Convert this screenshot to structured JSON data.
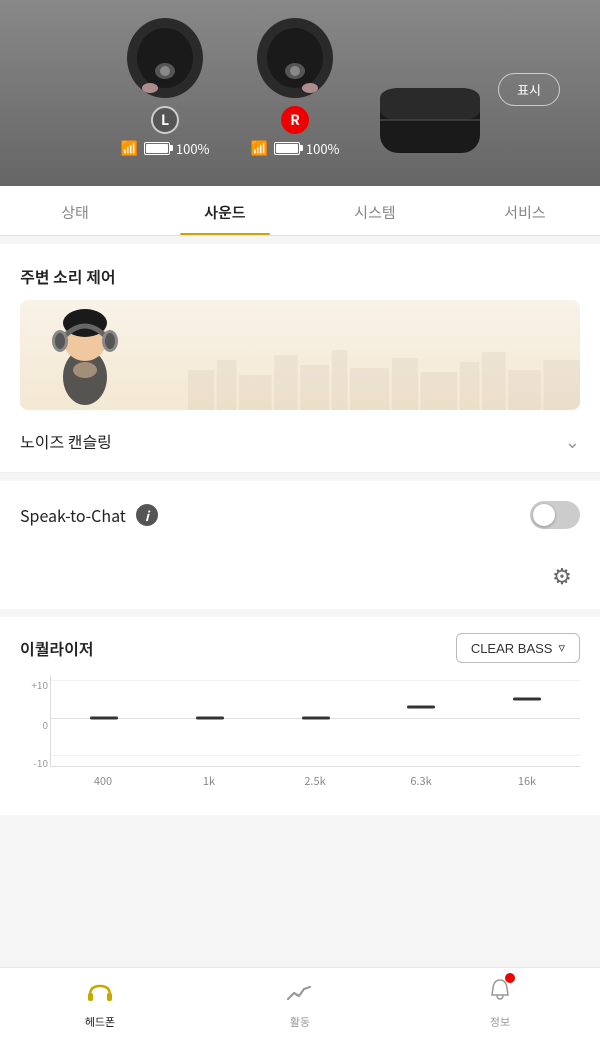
{
  "header": {
    "display_button": "표시"
  },
  "earbuds": {
    "left": {
      "badge": "L",
      "bluetooth": "⚡",
      "battery_pct": "100%"
    },
    "right": {
      "badge": "R",
      "bluetooth": "⚡",
      "battery_pct": "100%"
    }
  },
  "tabs": [
    {
      "id": "status",
      "label": "상태",
      "active": false
    },
    {
      "id": "sound",
      "label": "사운드",
      "active": true
    },
    {
      "id": "system",
      "label": "시스템",
      "active": false
    },
    {
      "id": "service",
      "label": "서비스",
      "active": false
    }
  ],
  "ambient": {
    "title": "주변 소리 제어"
  },
  "noise_cancelling": {
    "label": "노이즈 캔슬링"
  },
  "speak_to_chat": {
    "label": "Speak-to-Chat",
    "info_symbol": "i",
    "enabled": false
  },
  "equalizer": {
    "title": "이퀄라이저",
    "preset": "CLEAR BASS",
    "preset_icon": "◎",
    "bands": [
      {
        "freq": "400",
        "db": 0
      },
      {
        "freq": "1k",
        "db": 0
      },
      {
        "freq": "2.5k",
        "db": 0
      },
      {
        "freq": "6.3k",
        "db": 3
      },
      {
        "freq": "16k",
        "db": 5
      }
    ],
    "y_labels": [
      {
        "val": "+10",
        "pos_pct": 5
      },
      {
        "val": "0",
        "pos_pct": 47
      },
      {
        "val": "-10",
        "pos_pct": 88
      }
    ]
  },
  "bottom_nav": [
    {
      "id": "headphone",
      "label": "헤드폰",
      "icon": "🎧",
      "active": true
    },
    {
      "id": "activity",
      "label": "활동",
      "icon": "📈",
      "active": false
    },
    {
      "id": "info",
      "label": "정보",
      "icon": "🔔",
      "active": false,
      "badge": true
    }
  ]
}
